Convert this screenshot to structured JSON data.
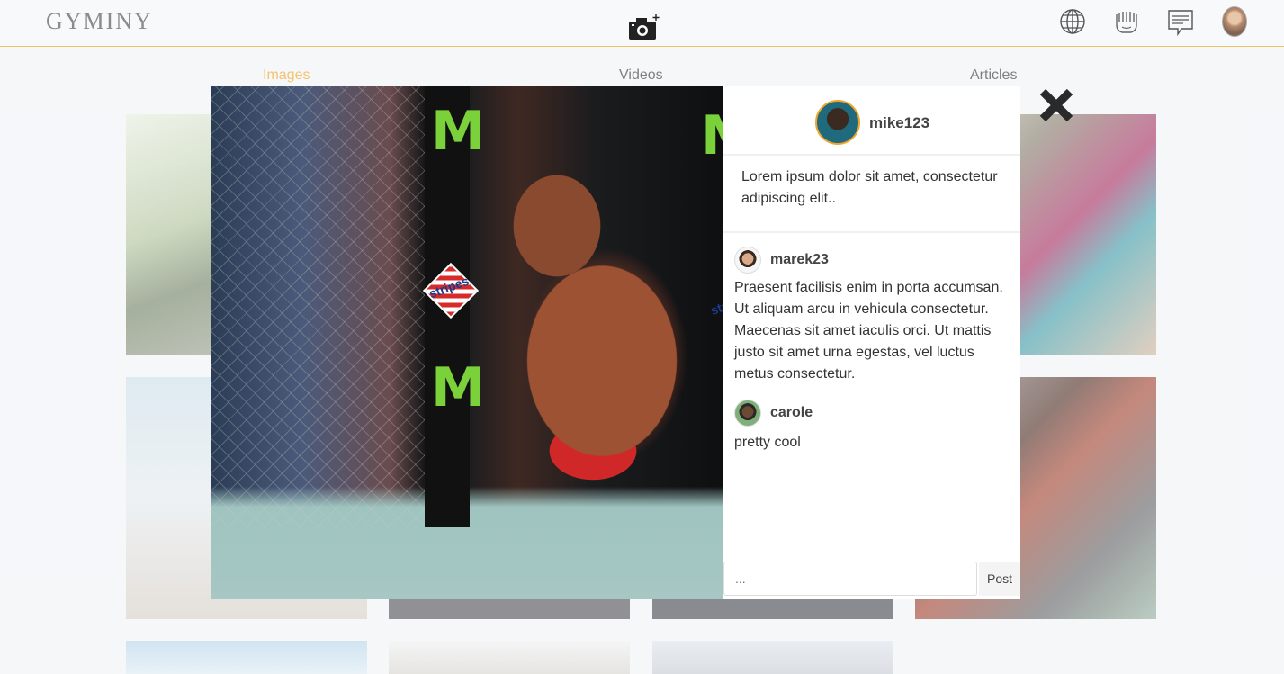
{
  "header": {
    "brand": "GYMINY",
    "icons": [
      "camera-plus-icon",
      "globe-icon",
      "fist-icon",
      "chat-icon",
      "profile-avatar"
    ]
  },
  "tabs": [
    {
      "label": "Images",
      "active": true
    },
    {
      "label": "Videos",
      "active": false
    },
    {
      "label": "Articles",
      "active": false
    }
  ],
  "modal": {
    "owner": {
      "username": "mike123"
    },
    "caption": "Lorem ipsum dolor sit amet, consectetur adipiscing elit..",
    "photo_text": {
      "brand_left": "stripes",
      "brand_right": "stripe"
    },
    "comments": [
      {
        "username": "marek23",
        "text": "Praesent facilisis enim in porta accumsan. Ut aliquam arcu in vehicula consectetur. Maecenas sit amet iaculis orci. Ut mattis justo sit amet urna egestas, vel luctus metus consectetur."
      },
      {
        "username": "carole",
        "text": "pretty cool"
      }
    ],
    "input_placeholder": "...",
    "post_label": "Post"
  },
  "colors": {
    "accent": "#f0a52a",
    "header_border": "#f0c062"
  }
}
